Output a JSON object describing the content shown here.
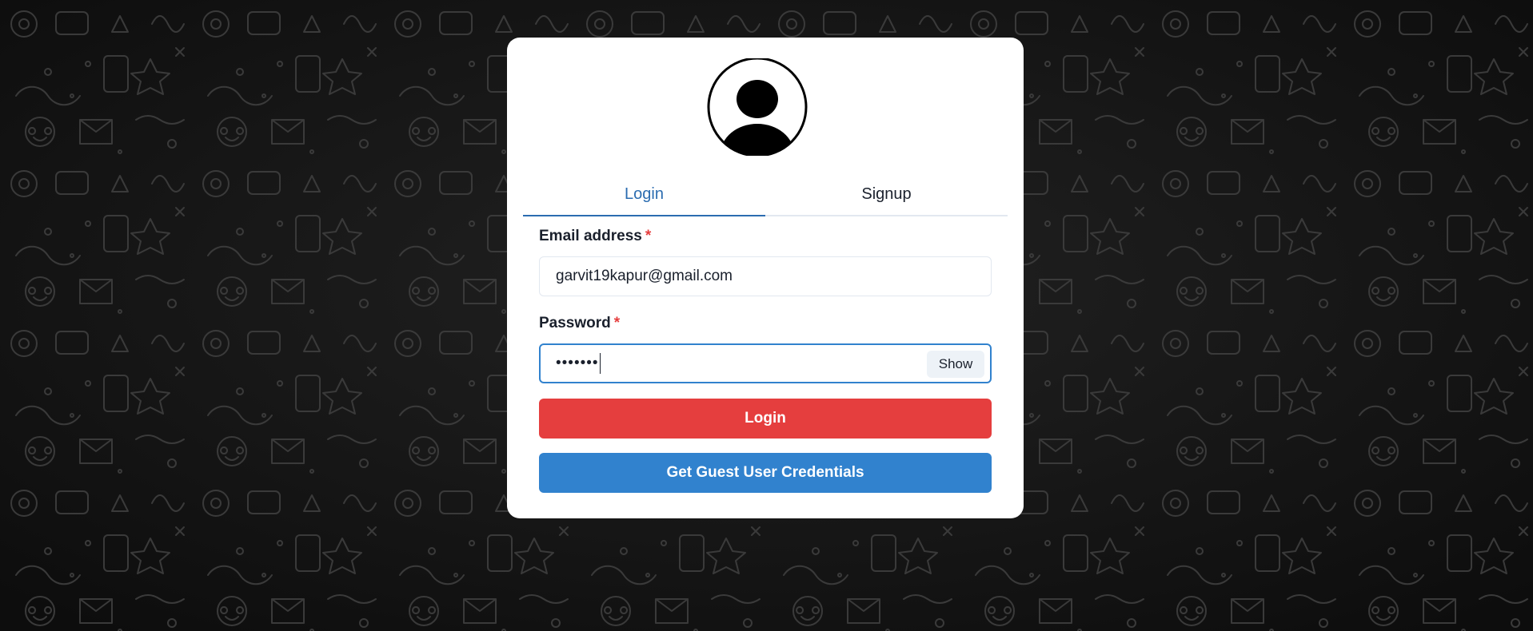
{
  "tabs": [
    {
      "label": "Login",
      "active": true
    },
    {
      "label": "Signup",
      "active": false
    }
  ],
  "form": {
    "email_label": "Email address",
    "required_mark": "*",
    "email_value": "garvit19kapur@gmail.com",
    "password_label": "Password",
    "password_masked": "•••••••",
    "show_label": "Show",
    "login_button": "Login",
    "guest_button": "Get Guest User Credentials"
  },
  "colors": {
    "background": "#141414",
    "active_tab": "#2b6cb0",
    "login_button": "#e53e3e",
    "guest_button": "#3182ce",
    "required": "#e53e3e"
  },
  "icons": {
    "avatar": "user-avatar-icon"
  }
}
